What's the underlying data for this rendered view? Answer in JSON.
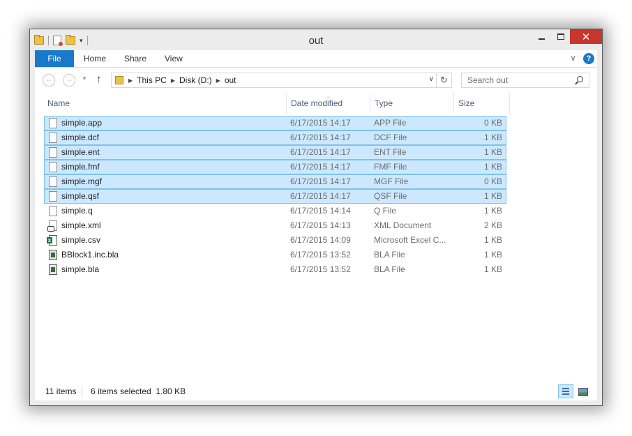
{
  "window": {
    "title": "out"
  },
  "quick_access": {
    "icons": [
      "folder-icon",
      "properties-icon",
      "new-folder-icon",
      "customize-dropdown-icon"
    ]
  },
  "window_controls": {
    "minimize_icon": "minimize-icon",
    "maximize_icon": "maximize-icon",
    "close_glyph": "✕"
  },
  "ribbon": {
    "tabs": [
      {
        "label": "File"
      },
      {
        "label": "Home"
      },
      {
        "label": "Share"
      },
      {
        "label": "View"
      }
    ],
    "expand_glyph": "∨",
    "help_glyph": "?"
  },
  "nav": {
    "back_glyph": "←",
    "forward_glyph": "→",
    "recent_glyph": "▼",
    "up_glyph": "↑",
    "breadcrumbs": [
      "This PC",
      "Disk (D:)",
      "out"
    ],
    "crumb_separator": "▶",
    "address_dropdown_glyph": "∨",
    "refresh_glyph": "↻",
    "search_placeholder": "Search out"
  },
  "columns": {
    "name": "Name",
    "date_modified": "Date modified",
    "type": "Type",
    "size": "Size",
    "sort_glyph": "︿"
  },
  "files": [
    {
      "name": "simple.app",
      "date": "6/17/2015 14:17",
      "type": "APP File",
      "size": "0 KB",
      "selected": true,
      "icon": "file-icon"
    },
    {
      "name": "simple.dcf",
      "date": "6/17/2015 14:17",
      "type": "DCF File",
      "size": "1 KB",
      "selected": true,
      "icon": "file-icon"
    },
    {
      "name": "simple.ent",
      "date": "6/17/2015 14:17",
      "type": "ENT File",
      "size": "1 KB",
      "selected": true,
      "icon": "file-icon"
    },
    {
      "name": "simple.fmf",
      "date": "6/17/2015 14:17",
      "type": "FMF File",
      "size": "1 KB",
      "selected": true,
      "icon": "file-icon"
    },
    {
      "name": "simple.mgf",
      "date": "6/17/2015 14:17",
      "type": "MGF File",
      "size": "0 KB",
      "selected": true,
      "icon": "file-icon"
    },
    {
      "name": "simple.qsf",
      "date": "6/17/2015 14:17",
      "type": "QSF File",
      "size": "1 KB",
      "selected": true,
      "icon": "file-icon"
    },
    {
      "name": "simple.q",
      "date": "6/17/2015 14:14",
      "type": "Q File",
      "size": "1 KB",
      "selected": false,
      "icon": "file-icon"
    },
    {
      "name": "simple.xml",
      "date": "6/17/2015 14:13",
      "type": "XML Document",
      "size": "2 KB",
      "selected": false,
      "icon": "xml-file-icon"
    },
    {
      "name": "simple.csv",
      "date": "6/17/2015 14:09",
      "type": "Microsoft Excel C...",
      "size": "1 KB",
      "selected": false,
      "icon": "excel-file-icon"
    },
    {
      "name": "BBlock1.inc.bla",
      "date": "6/17/2015 13:52",
      "type": "BLA File",
      "size": "1 KB",
      "selected": false,
      "icon": "bla-file-icon"
    },
    {
      "name": "simple.bla",
      "date": "6/17/2015 13:52",
      "type": "BLA File",
      "size": "1 KB",
      "selected": false,
      "icon": "bla-file-icon"
    }
  ],
  "status": {
    "item_count": "11 items",
    "selection": "6 items selected  1.80 KB"
  },
  "colors": {
    "accent": "#1979ca",
    "selection_bg": "#cce8ff",
    "selection_border": "#7ec3e8",
    "close_button": "#c7362d"
  }
}
